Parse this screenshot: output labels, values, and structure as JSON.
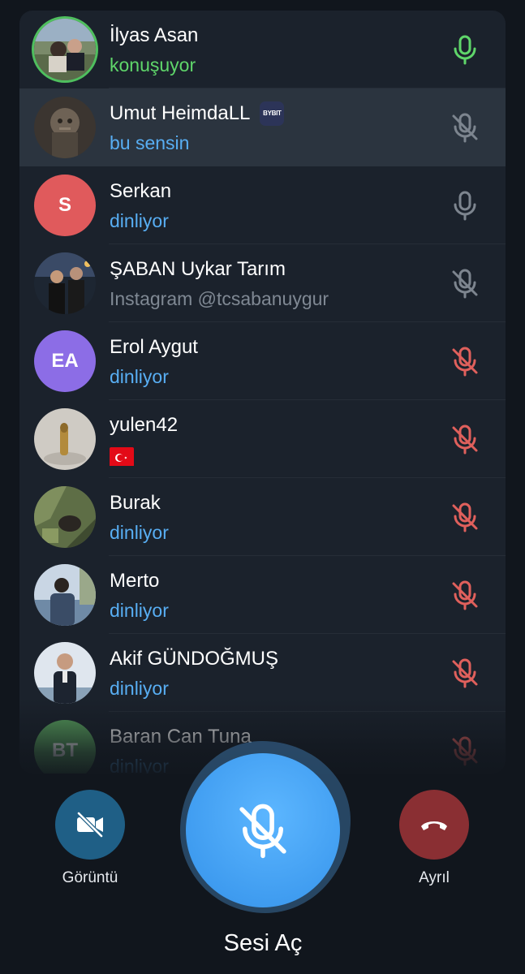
{
  "participants": [
    {
      "name": "İlyas Asan",
      "status": "konuşuyor",
      "status_color": "green",
      "mic": "active",
      "avatar": "photo-group"
    },
    {
      "name": "Umut HeimdaLL",
      "badge": "BYBIT",
      "status": "bu sensin",
      "status_color": "blue",
      "mic": "muted-gray",
      "avatar": "photo-statue",
      "highlight": true
    },
    {
      "name": "Serkan",
      "initials": "S",
      "avatar_color": "#e05a5c",
      "status": "dinliyor",
      "status_color": "blue",
      "mic": "open-gray"
    },
    {
      "name": "ŞABAN Uykar Tarım",
      "status": "Instagram @tcsabanuygur",
      "status_color": "gray",
      "mic": "muted-gray",
      "avatar": "photo-night"
    },
    {
      "name": "Erol Aygut",
      "initials": "EA",
      "avatar_color": "#8c6de6",
      "status": "dinliyor",
      "status_color": "blue",
      "mic": "muted-red"
    },
    {
      "name": "yulen42",
      "status": "🇹🇷",
      "status_color": "flag",
      "mic": "muted-red",
      "avatar": "photo-bullet"
    },
    {
      "name": "Burak",
      "status": "dinliyor",
      "status_color": "blue",
      "mic": "muted-red",
      "avatar": "photo-nature"
    },
    {
      "name": "Merto",
      "status": "dinliyor",
      "status_color": "blue",
      "mic": "muted-red",
      "avatar": "photo-sea"
    },
    {
      "name": "Akif GÜNDOĞMUŞ",
      "status": "dinliyor",
      "status_color": "blue",
      "mic": "muted-red",
      "avatar": "photo-portrait"
    },
    {
      "name": "Baran Can Tuna",
      "initials": "BT",
      "avatar_color": "#5aa35e",
      "status": "dinliyor",
      "status_color": "blue",
      "mic": "muted-red"
    }
  ],
  "controls": {
    "video_label": "Görüntü",
    "leave_label": "Ayrıl",
    "unmute_label": "Sesi Aç"
  },
  "colors": {
    "background": "#11161d",
    "panel": "#1b222c",
    "highlight_row": "#2b343f",
    "accent_blue": "#58aef3",
    "speaking_green": "#5fd66a",
    "mute_red": "#e0605c",
    "video_button": "#1f5f86",
    "leave_button": "#8a2f33",
    "main_button": "#3f9cf0"
  }
}
